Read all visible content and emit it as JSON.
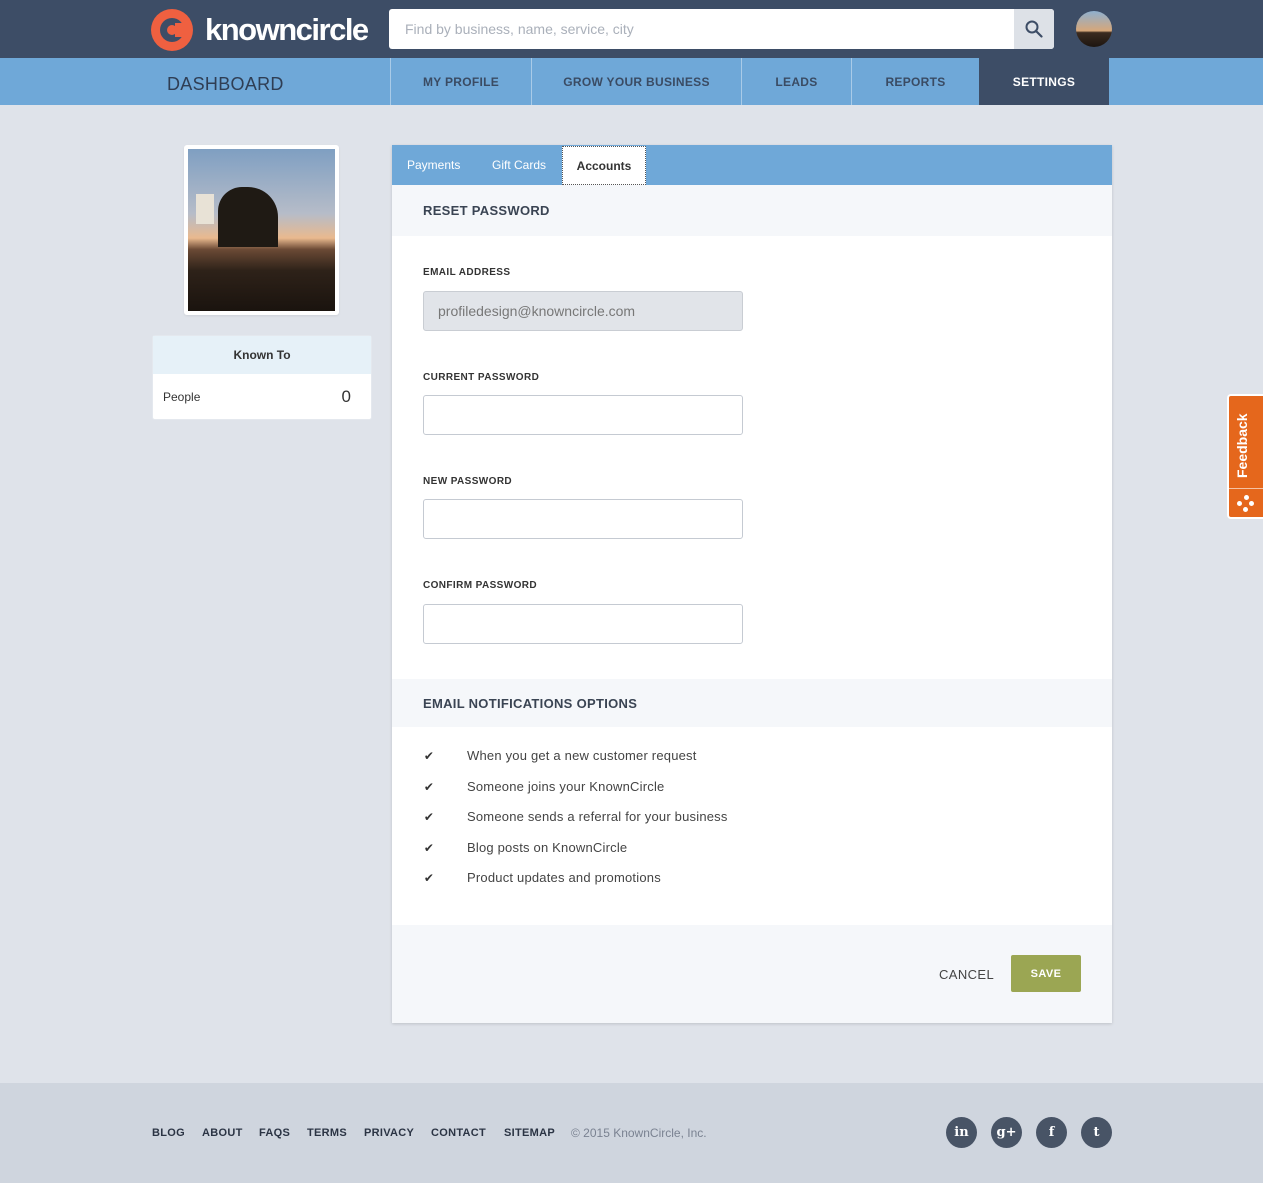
{
  "header": {
    "logo_text": "knowncircle",
    "search": {
      "placeholder": "Find by business, name, service, city"
    }
  },
  "nav": {
    "title": "DASHBOARD",
    "items": [
      {
        "label": "MY PROFILE",
        "active": false
      },
      {
        "label": "GROW YOUR BUSINESS",
        "active": false
      },
      {
        "label": "LEADS",
        "active": false
      },
      {
        "label": "REPORTS",
        "active": false
      },
      {
        "label": "SETTINGS",
        "active": true
      }
    ]
  },
  "sidebar": {
    "known_to": {
      "title": "Known To",
      "label": "People",
      "count": "0"
    }
  },
  "tabs": [
    {
      "label": "Payments",
      "active": false
    },
    {
      "label": "Gift Cards",
      "active": false
    },
    {
      "label": "Accounts",
      "active": true
    }
  ],
  "reset_password": {
    "heading": "RESET PASSWORD",
    "email_label": "EMAIL ADDRESS",
    "email_value": "profiledesign@knowncircle.com",
    "current_label": "CURRENT PASSWORD",
    "new_label": "NEW PASSWORD",
    "confirm_label": "CONFIRM PASSWORD"
  },
  "notifications": {
    "heading": "EMAIL NOTIFICATIONS OPTIONS",
    "items": [
      {
        "label": "When you get a new customer request",
        "checked": true
      },
      {
        "label": "Someone joins your KnownCircle",
        "checked": true
      },
      {
        "label": "Someone sends a referral for your business",
        "checked": true
      },
      {
        "label": "Blog posts on KnownCircle",
        "checked": true
      },
      {
        "label": "Product updates and promotions",
        "checked": true
      }
    ]
  },
  "actions": {
    "cancel": "CANCEL",
    "save": "SAVE"
  },
  "feedback": {
    "label": "Feedback"
  },
  "footer": {
    "links": [
      "BLOG",
      "ABOUT",
      "FAQS",
      "TERMS",
      "PRIVACY",
      "CONTACT",
      "SITEMAP"
    ],
    "copyright": "© 2015 KnownCircle, Inc.",
    "social": [
      {
        "icon": "linkedin-icon",
        "glyph": "in"
      },
      {
        "icon": "google-plus-icon",
        "glyph": "g+"
      },
      {
        "icon": "facebook-icon",
        "glyph": "f"
      },
      {
        "icon": "twitter-icon",
        "glyph": "t"
      }
    ]
  },
  "colors": {
    "topbar": "#3d4d66",
    "nav": "#6fa8d8",
    "brand_orange": "#ef6040",
    "save_button": "#9ba653",
    "feedback": "#e5671c"
  }
}
